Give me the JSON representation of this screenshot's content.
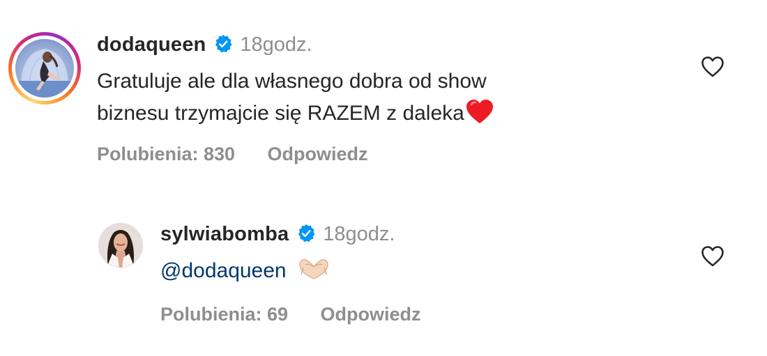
{
  "comments": [
    {
      "username": "dodaqueen",
      "time": "18godz.",
      "text_line1": "Gratuluje ale dla własnego dobra od show",
      "text_line2": "biznesu trzymajcie się RAZEM z daleka",
      "emoji": "❤️",
      "likes": "Polubienia: 830",
      "reply": "Odpowiedz",
      "has_story_ring": true
    },
    {
      "username": "sylwiabomba",
      "time": "18godz.",
      "mention": "@dodaqueen",
      "emoji": "🫶🏻",
      "likes": "Polubienia: 69",
      "reply": "Odpowiedz",
      "has_story_ring": false
    }
  ],
  "colors": {
    "text": "#262626",
    "secondary": "#8e8e8e",
    "verified": "#0095f6",
    "mention": "#00376b",
    "heart_emoji": "#ed1c24"
  },
  "icons": {
    "verified": "verified-badge-icon",
    "like": "heart-outline-icon"
  }
}
